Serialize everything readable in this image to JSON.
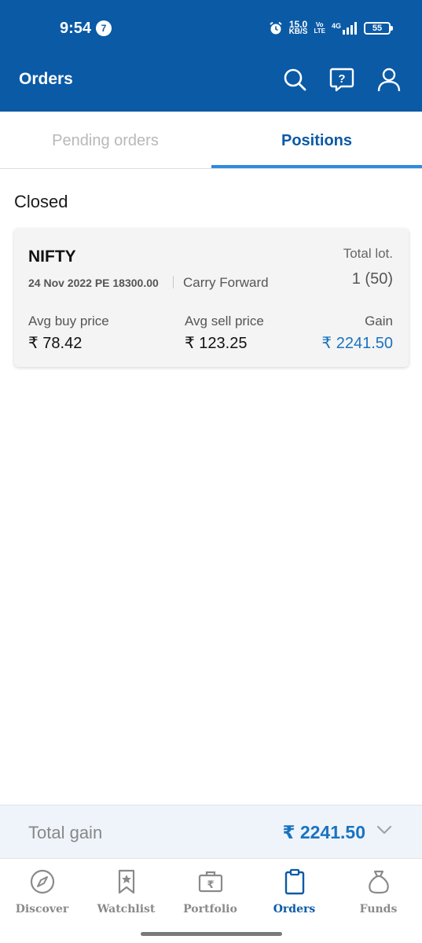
{
  "status": {
    "time": "9:54",
    "notification_badge": "7",
    "net_speed_value": "15.0",
    "net_speed_unit": "KB/S",
    "volte_top": "Vo",
    "volte_bottom": "LTE",
    "network": "4G",
    "battery": "55"
  },
  "appbar": {
    "title": "Orders",
    "icons": [
      "search-icon",
      "help-icon",
      "profile-icon"
    ]
  },
  "tabs": {
    "pending": "Pending orders",
    "positions": "Positions",
    "active": "positions"
  },
  "section": {
    "title": "Closed"
  },
  "position": {
    "symbol": "NIFTY",
    "contract": "24 Nov 2022 PE 18300.00",
    "product": "Carry Forward",
    "total_lot_label": "Total lot.",
    "total_lot_value": "1 (50)",
    "avg_buy_label": "Avg buy price",
    "avg_buy_value": "₹ 78.42",
    "avg_sell_label": "Avg sell price",
    "avg_sell_value": "₹ 123.25",
    "gain_label": "Gain",
    "gain_value": "₹ 2241.50"
  },
  "summary": {
    "total_gain_label": "Total gain",
    "total_gain_value": "₹ 2241.50"
  },
  "nav": {
    "items": [
      {
        "label": "Discover",
        "icon": "compass-icon"
      },
      {
        "label": "Watchlist",
        "icon": "bookmark-star-icon"
      },
      {
        "label": "Portfolio",
        "icon": "briefcase-rupee-icon"
      },
      {
        "label": "Orders",
        "icon": "clipboard-icon"
      },
      {
        "label": "Funds",
        "icon": "money-bag-icon"
      }
    ],
    "active": "Orders"
  },
  "colors": {
    "brand_blue": "#0a5aa6",
    "tab_indicator": "#2d8cde",
    "gain_blue": "#1a73c0"
  }
}
